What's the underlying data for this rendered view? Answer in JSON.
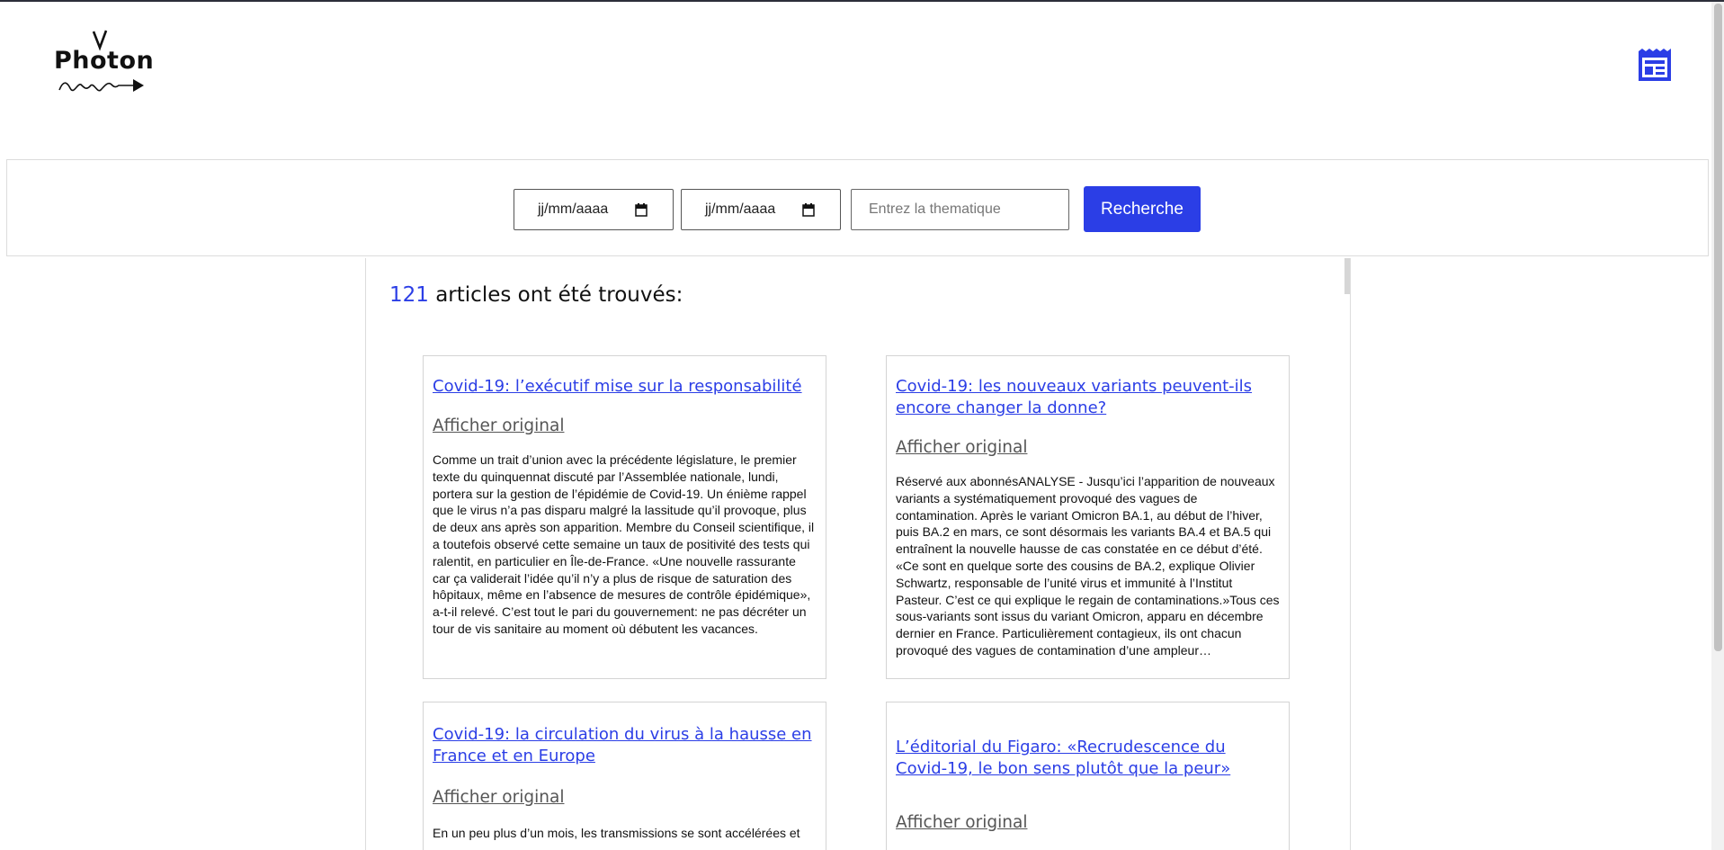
{
  "header": {
    "logo_text": "Photon"
  },
  "search": {
    "date_from": "jj/mm/aaaa",
    "date_to": "jj/mm/aaaa",
    "theme_placeholder": "Entrez la thematique",
    "button_label": "Recherche"
  },
  "results": {
    "count": "121",
    "count_suffix": " articles ont été trouvés:",
    "original_label": "Afficher original",
    "articles": [
      {
        "title": "Covid-19: l’exécutif mise sur la responsabilité",
        "excerpt": "Comme un trait d’union avec la précédente législature, le premier texte du quinquennat discuté par l’Assemblée nationale, lundi, portera sur la gestion de l’épidémie de Covid-19. Un énième rappel que le virus n’a pas disparu malgré la lassitude qu’il provoque, plus de deux ans après son apparition. Membre du Conseil scientifique, il a toutefois observé cette semaine un taux de positivité des tests qui ralentit, en particulier en Île-de-France. «Une nouvelle rassurante car ça validerait l’idée qu’il n’y a plus de risque de saturation des hôpitaux, même en l’absence de mesures de contrôle épidémique», a-t-il relevé. C’est tout le pari du gouvernement: ne pas décréter un tour de vis sanitaire au moment où débutent les vacances."
      },
      {
        "title": "Covid-19: les nouveaux variants peuvent-ils encore changer la donne?",
        "excerpt": "Réservé aux abonnésANALYSE - Jusqu’ici l’apparition de nouveaux variants a systématiquement provoqué des vagues de contamination. Après le variant Omicron BA.1, au début de l’hiver, puis BA.2 en mars, ce sont désormais les variants BA.4 et BA.5 qui entraînent la nouvelle hausse de cas constatée en ce début d’été. «Ce sont en quelque sorte des cousins de BA.2, explique Olivier Schwartz, responsable de l’unité virus et immunité à l’Institut Pasteur. C’est ce qui explique le regain de contaminations.»Tous ces sous-variants sont issus du variant Omicron, apparu en décembre dernier en France. Particulièrement contagieux, ils ont chacun provoqué des vagues de contamination d’une ampleur…"
      },
      {
        "title": "Covid-19: la circulation du virus à la hausse en France et en Europe",
        "excerpt": "En un peu plus d’un mois, les transmissions se sont accélérées et"
      },
      {
        "title": "L’éditorial du Figaro: «Recrudescence du Covid-19, le bon sens plutôt que la peur»",
        "excerpt": ""
      }
    ]
  }
}
